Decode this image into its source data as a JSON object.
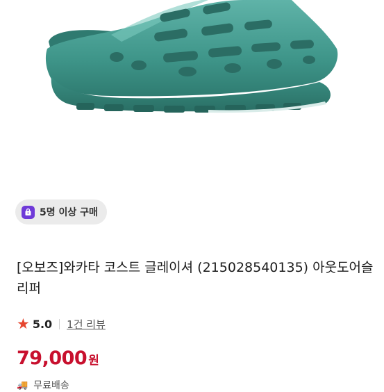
{
  "product": {
    "image_alt": "teal clog sandal",
    "badge": {
      "icon": "shopping-bag-icon",
      "label": "5명 이상 구매",
      "icon_color": "#6f3ad8"
    },
    "title": "[오보즈]와카타 코스트 글레이셔 (215028540135) 아웃도어슬리퍼",
    "rating": {
      "icon": "star-icon",
      "value": "5.0",
      "review_link": "1건 리뷰"
    },
    "price": {
      "amount": "79,000",
      "unit": "원",
      "color": "#c8102e"
    },
    "shipping": {
      "icon": "truck-icon",
      "label": "무료배송"
    }
  }
}
